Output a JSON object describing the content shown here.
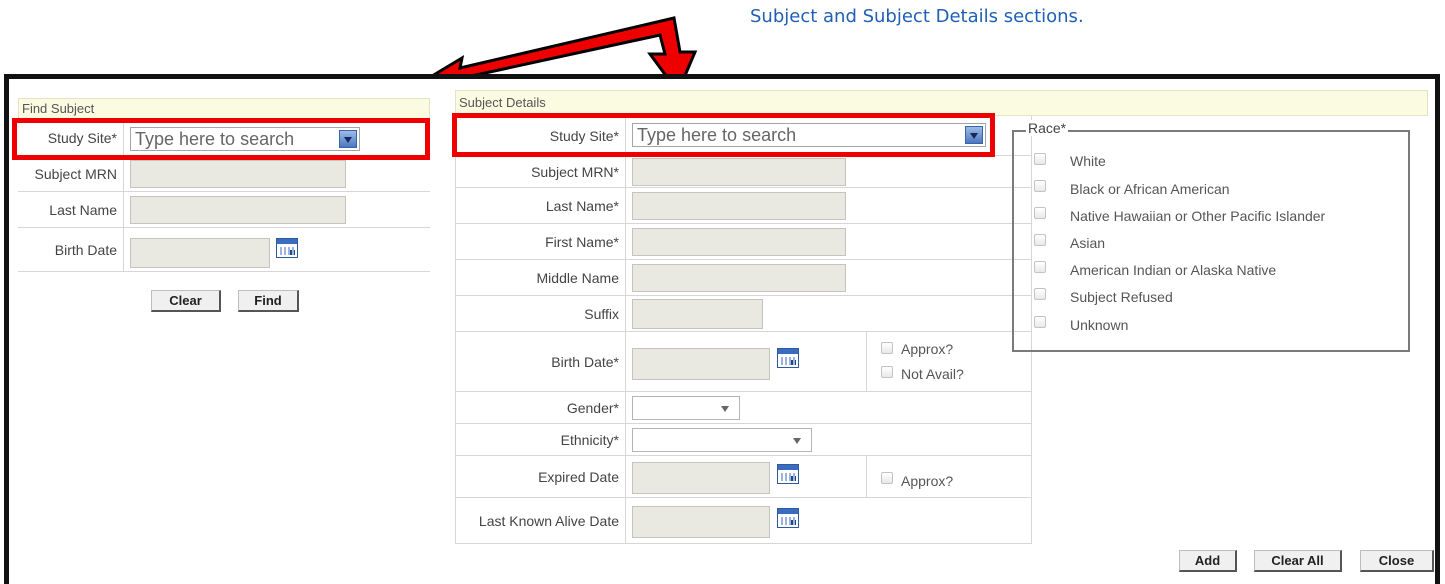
{
  "caption": "Subject and Subject Details sections.",
  "colors": {
    "annotation_red": "#ee0000",
    "caption_blue": "#1f5fb4",
    "section_header_bg": "#fbfbe2",
    "combo_button_blue": "#4b78c3"
  },
  "find_subject": {
    "header": "Find Subject",
    "study_site_label": "Study Site*",
    "study_site_placeholder": "Type here to search",
    "mrn_label": "Subject MRN",
    "last_name_label": "Last Name",
    "birth_date_label": "Birth Date",
    "clear_button": "Clear",
    "find_button": "Find"
  },
  "subject_details": {
    "header": "Subject Details",
    "study_site_label": "Study Site*",
    "study_site_placeholder": "Type here to search",
    "mrn_label": "Subject MRN*",
    "last_name_label": "Last Name*",
    "first_name_label": "First Name*",
    "middle_name_label": "Middle Name",
    "suffix_label": "Suffix",
    "birth_date_label": "Birth Date*",
    "approx_label": "Approx?",
    "not_avail_label": "Not Avail?",
    "gender_label": "Gender*",
    "ethnicity_label": "Ethnicity*",
    "expired_date_label": "Expired Date",
    "expired_approx_label": "Approx?",
    "last_alive_label": "Last Known Alive Date"
  },
  "race": {
    "legend": "Race*",
    "options": [
      "White",
      "Black or African American",
      "Native Hawaiian or Other Pacific Islander",
      "Asian",
      "American Indian or Alaska Native",
      "Subject Refused",
      "Unknown"
    ]
  },
  "footer": {
    "add_button": "Add",
    "clear_all_button": "Clear All",
    "close_button": "Close"
  }
}
